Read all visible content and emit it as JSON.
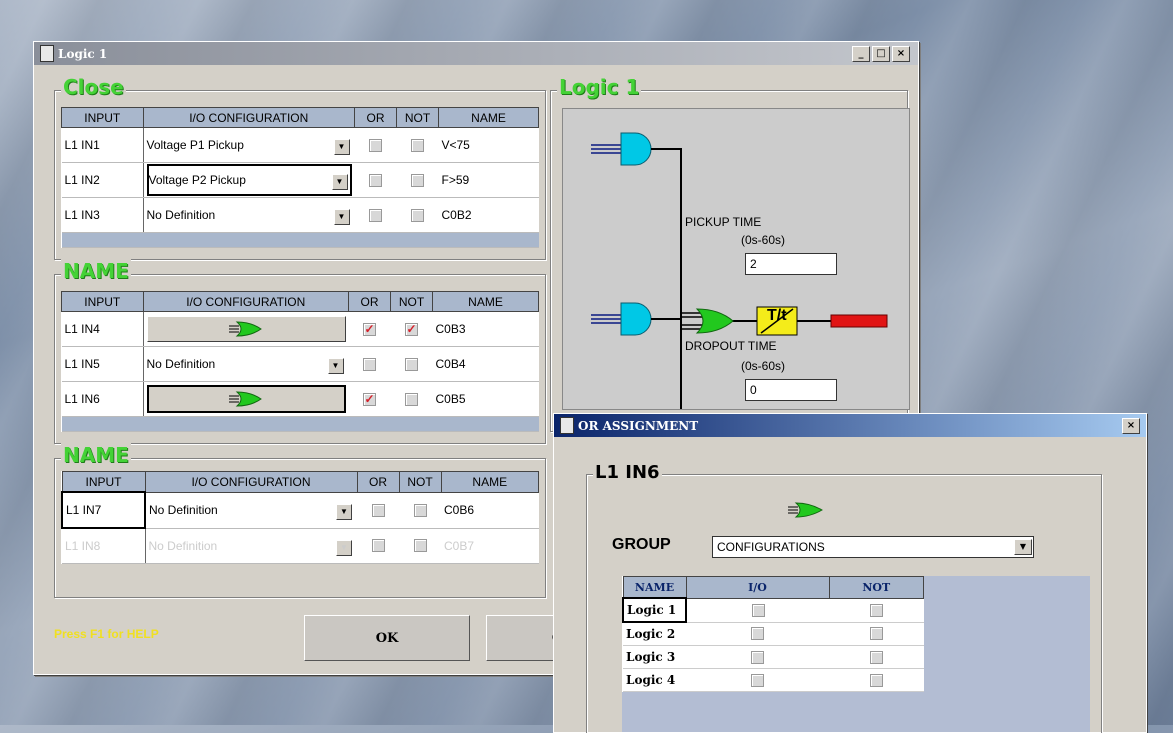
{
  "main_window": {
    "title": "Logic 1",
    "title_buttons": [
      "_",
      "□",
      "×"
    ]
  },
  "table_headers": [
    "INPUT",
    "I/O CONFIGURATION",
    "OR",
    "NOT",
    "NAME"
  ],
  "groups": [
    {
      "title": "Close",
      "rows": [
        {
          "input": "L1 IN1",
          "config": "Voltage P1 Pickup",
          "or": false,
          "not": false,
          "name": "V<75"
        },
        {
          "input": "L1 IN2",
          "config": "Voltage P2 Pickup",
          "or": false,
          "not": false,
          "name": "F>59"
        },
        {
          "input": "L1 IN3",
          "config": "No Definition",
          "or": false,
          "not": false,
          "name": "C0B2"
        }
      ]
    },
    {
      "title": "NAME",
      "rows": [
        {
          "input": "L1 IN4",
          "config": "",
          "gate": true,
          "or": true,
          "not": true,
          "name": "C0B3"
        },
        {
          "input": "L1 IN5",
          "config": "No Definition",
          "or": false,
          "not": false,
          "name": "C0B4"
        },
        {
          "input": "L1 IN6",
          "config": "",
          "gate": true,
          "or": true,
          "not": false,
          "name": "C0B5"
        }
      ]
    },
    {
      "title": "NAME",
      "rows": [
        {
          "input": "L1 IN7",
          "config": "No Definition",
          "or": false,
          "not": false,
          "name": "C0B6"
        },
        {
          "input": "L1 IN8",
          "config": "No Definition",
          "or": false,
          "not": false,
          "name": "C0B7",
          "disabled": true
        }
      ]
    }
  ],
  "logic_panel": {
    "title": "Logic 1",
    "pickup_label": "PICKUP TIME",
    "pickup_range": "(0s-60s)",
    "pickup_value": "2",
    "dropout_label": "DROPOUT TIME",
    "dropout_range": "(0s-60s)",
    "dropout_value": "0",
    "timer_label": "T/t"
  },
  "footer": {
    "help": "Press F1 for HELP",
    "ok": "OK",
    "cancel": "C"
  },
  "or_dialog": {
    "title": "OR ASSIGNMENT",
    "close": "×",
    "group_title": "L1 IN6",
    "group_label": "GROUP",
    "group_value": "CONFIGURATIONS",
    "headers": [
      "NAME",
      "I/O",
      "NOT"
    ],
    "rows": [
      {
        "name": "Logic 1"
      },
      {
        "name": "Logic 2"
      },
      {
        "name": "Logic 3"
      },
      {
        "name": "Logic 4"
      }
    ]
  },
  "colors": {
    "group_title_green": "#44d236",
    "help_yellow": "#f0e020",
    "header_blue": "#a9b7cc",
    "gate_cyan": "#00c8e6",
    "gate_green": "#22c81e",
    "timer_yellow": "#f4ec1a",
    "output_red": "#e11414"
  }
}
